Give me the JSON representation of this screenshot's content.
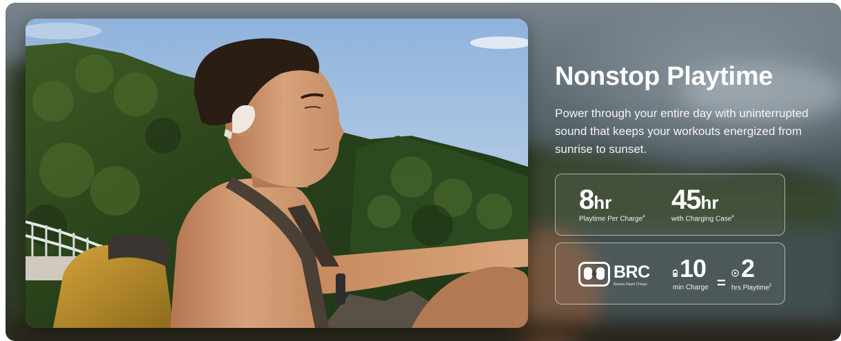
{
  "section": {
    "title": "Nonstop Playtime",
    "description": "Power through your entire day with uninterrupted sound that keeps your workouts energized from sunrise to sunset."
  },
  "stats_primary": [
    {
      "value": "8",
      "unit": "hr",
      "caption": "Playtime Per Charge",
      "note": "4"
    },
    {
      "value": "45",
      "unit": "hr",
      "caption": "with Charging Case",
      "note": "4"
    }
  ],
  "fast_charge": {
    "logo_text": "BRC",
    "logo_subtext": "Baseus Rapid Charge",
    "charge_value": "10",
    "charge_caption": "min Charge",
    "equals": "=",
    "play_value": "2",
    "play_caption": "hrs Playtime",
    "play_note": "5"
  },
  "colors": {
    "text": "#ffffff",
    "card_border": "#ffffff",
    "sky": "#a9c6e4",
    "hill": "#2f4a1f",
    "backpack": "#c0952c"
  },
  "icons": [
    "battery-icon",
    "play-circle-icon",
    "earbuds-case-icon"
  ]
}
